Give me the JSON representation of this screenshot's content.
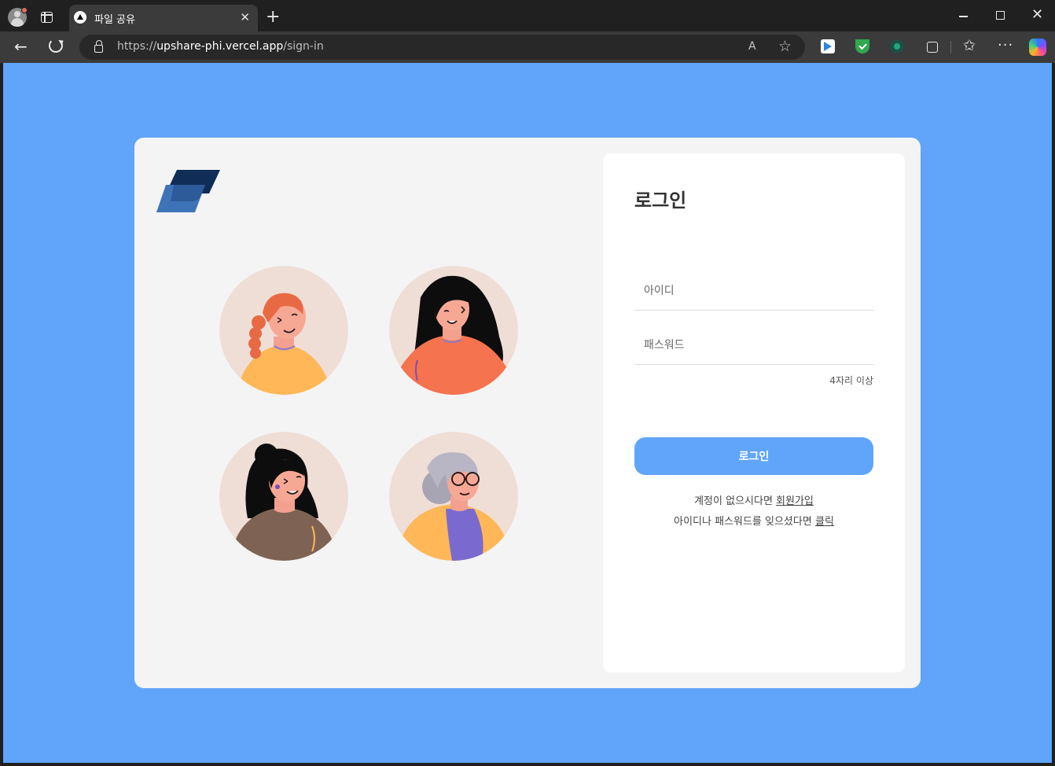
{
  "browser": {
    "tab_title": "파일 공유",
    "url_prefix": "https://",
    "url_host": "upshare-phi.vercel.app",
    "url_path": "/sign-in",
    "tab_close": "✕",
    "new_tab": "+",
    "back": "←",
    "read_aloud": "A",
    "favorite": "☆",
    "favorites_bar": "✩",
    "more": "···",
    "close_window": "✕"
  },
  "login": {
    "title": "로그인",
    "id_placeholder": "아이디",
    "password_placeholder": "패스워드",
    "password_hint": "4자리 이상",
    "button_label": "로그인",
    "no_account_text": "계정이 없으시다면 ",
    "signup_link": "회원가입",
    "forgot_text": "아이디나 패스워드를 잊으셨다면 ",
    "forgot_link": "클릭"
  },
  "colors": {
    "background": "#60a5fa",
    "card": "#f4f4f4",
    "panel": "#ffffff",
    "button": "#60a5fa",
    "logo_dark": "#0f2d56",
    "logo_blue": "#3e74b7"
  }
}
